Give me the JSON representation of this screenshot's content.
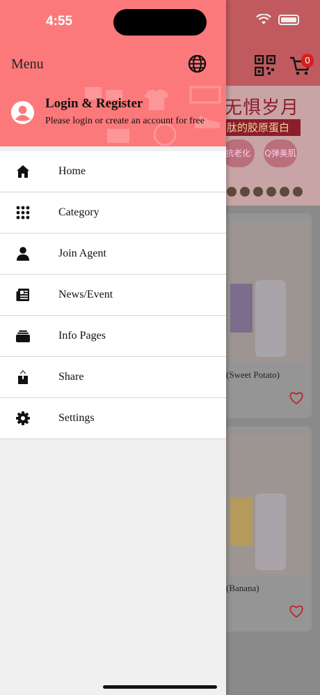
{
  "status_bar": {
    "time": "4:55"
  },
  "drawer": {
    "title": "Menu",
    "language_icon": "globe-icon",
    "account": {
      "title": "Login & Register",
      "subtitle": "Please login or create an account for free",
      "avatar_icon": "user-avatar-icon"
    },
    "items": [
      {
        "label": "Home",
        "icon": "home-icon"
      },
      {
        "label": "Category",
        "icon": "grid-dots-icon"
      },
      {
        "label": "Join Agent",
        "icon": "person-icon"
      },
      {
        "label": "News/Event",
        "icon": "newspaper-icon"
      },
      {
        "label": "Info Pages",
        "icon": "folder-stack-icon"
      },
      {
        "label": "Share",
        "icon": "share-icon"
      },
      {
        "label": "Settings",
        "icon": "gear-icon"
      }
    ]
  },
  "background": {
    "cart_count": "0",
    "banner_title": "无惧岁月",
    "banner_subtitle": "肽的胶原蛋白",
    "banner_badges": [
      "抗老化",
      "Q弹美肌"
    ],
    "products": [
      {
        "name": "(Sweet Potato)"
      },
      {
        "name": "(Banana)"
      }
    ]
  },
  "colors": {
    "accent": "#fc797b",
    "header_dim": "#c15a5e"
  }
}
